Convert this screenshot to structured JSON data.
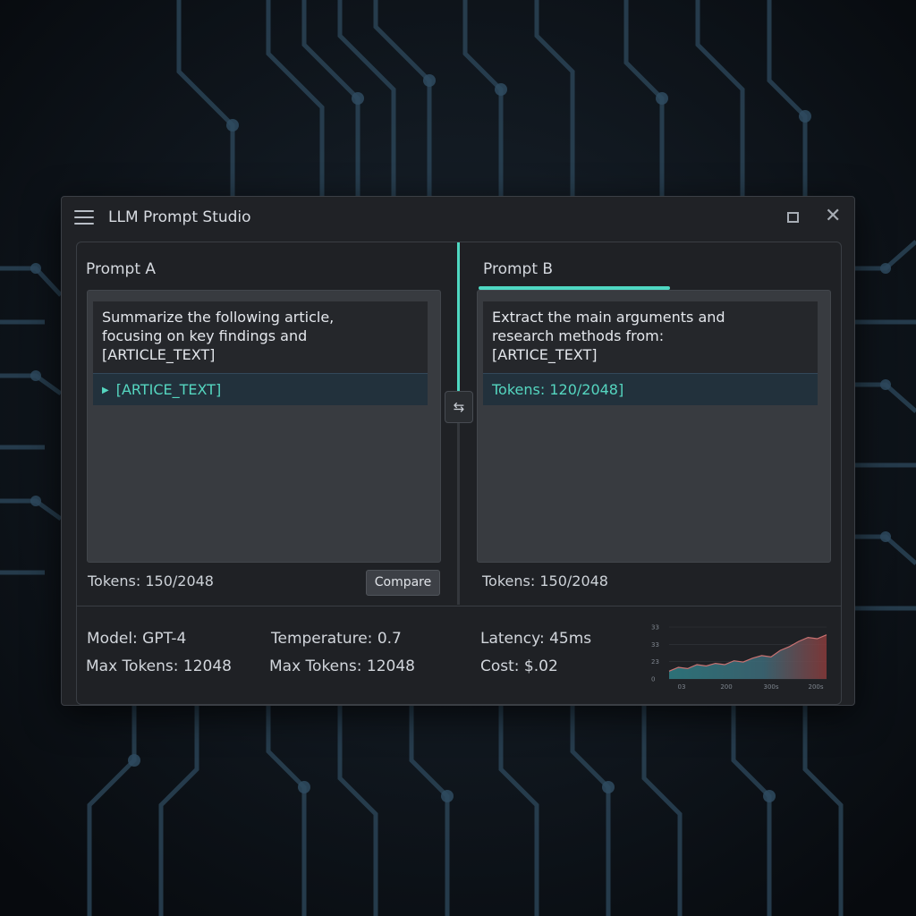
{
  "window": {
    "title": "LLM Prompt Studio"
  },
  "icons": {
    "menu": "hamburger-menu-icon",
    "maximize": "maximize-icon",
    "close": "close-icon",
    "swap": "swap-arrows-icon"
  },
  "prompt_a": {
    "title": "Prompt A",
    "text_lines": [
      "Summarize the following article,",
      "focusing on key findings and",
      "[ARTICLE_TEXT]"
    ],
    "variable": "[ARTICE_TEXT]",
    "tokens": "Tokens: 150/2048"
  },
  "prompt_b": {
    "title": "Prompt B",
    "text_lines": [
      "Extract the main arguments and",
      "research methods from:",
      "[ARTICE_TEXT]"
    ],
    "token_row": "Tokens: 120/2048]",
    "tokens": "Tokens: 150/2048"
  },
  "compare_button": {
    "label": "Compare"
  },
  "swap_button": {
    "label": "⇆"
  },
  "stats": {
    "model": "Model: GPT-4",
    "max_tokens_a": "Max Tokens: 12048",
    "temperature": "Temperature: 0.7",
    "max_tokens_b": "Max Tokens: 12048",
    "latency": "Latency: 45ms",
    "cost": "Cost:  $.02"
  },
  "colors": {
    "accent": "#4fd8c2",
    "chart_low": "#2f7f86",
    "chart_high": "#8a3a3a"
  },
  "chart_data": {
    "type": "area",
    "y_tick_labels": [
      "33",
      "33",
      "23",
      "0"
    ],
    "x_tick_labels": [
      "03",
      "200",
      "300s",
      "200s"
    ],
    "y_range": [
      0,
      40
    ],
    "values": [
      6,
      9,
      8,
      11,
      10,
      12,
      11,
      14,
      13,
      16,
      18,
      17,
      22,
      25,
      29,
      32,
      31,
      34
    ]
  }
}
